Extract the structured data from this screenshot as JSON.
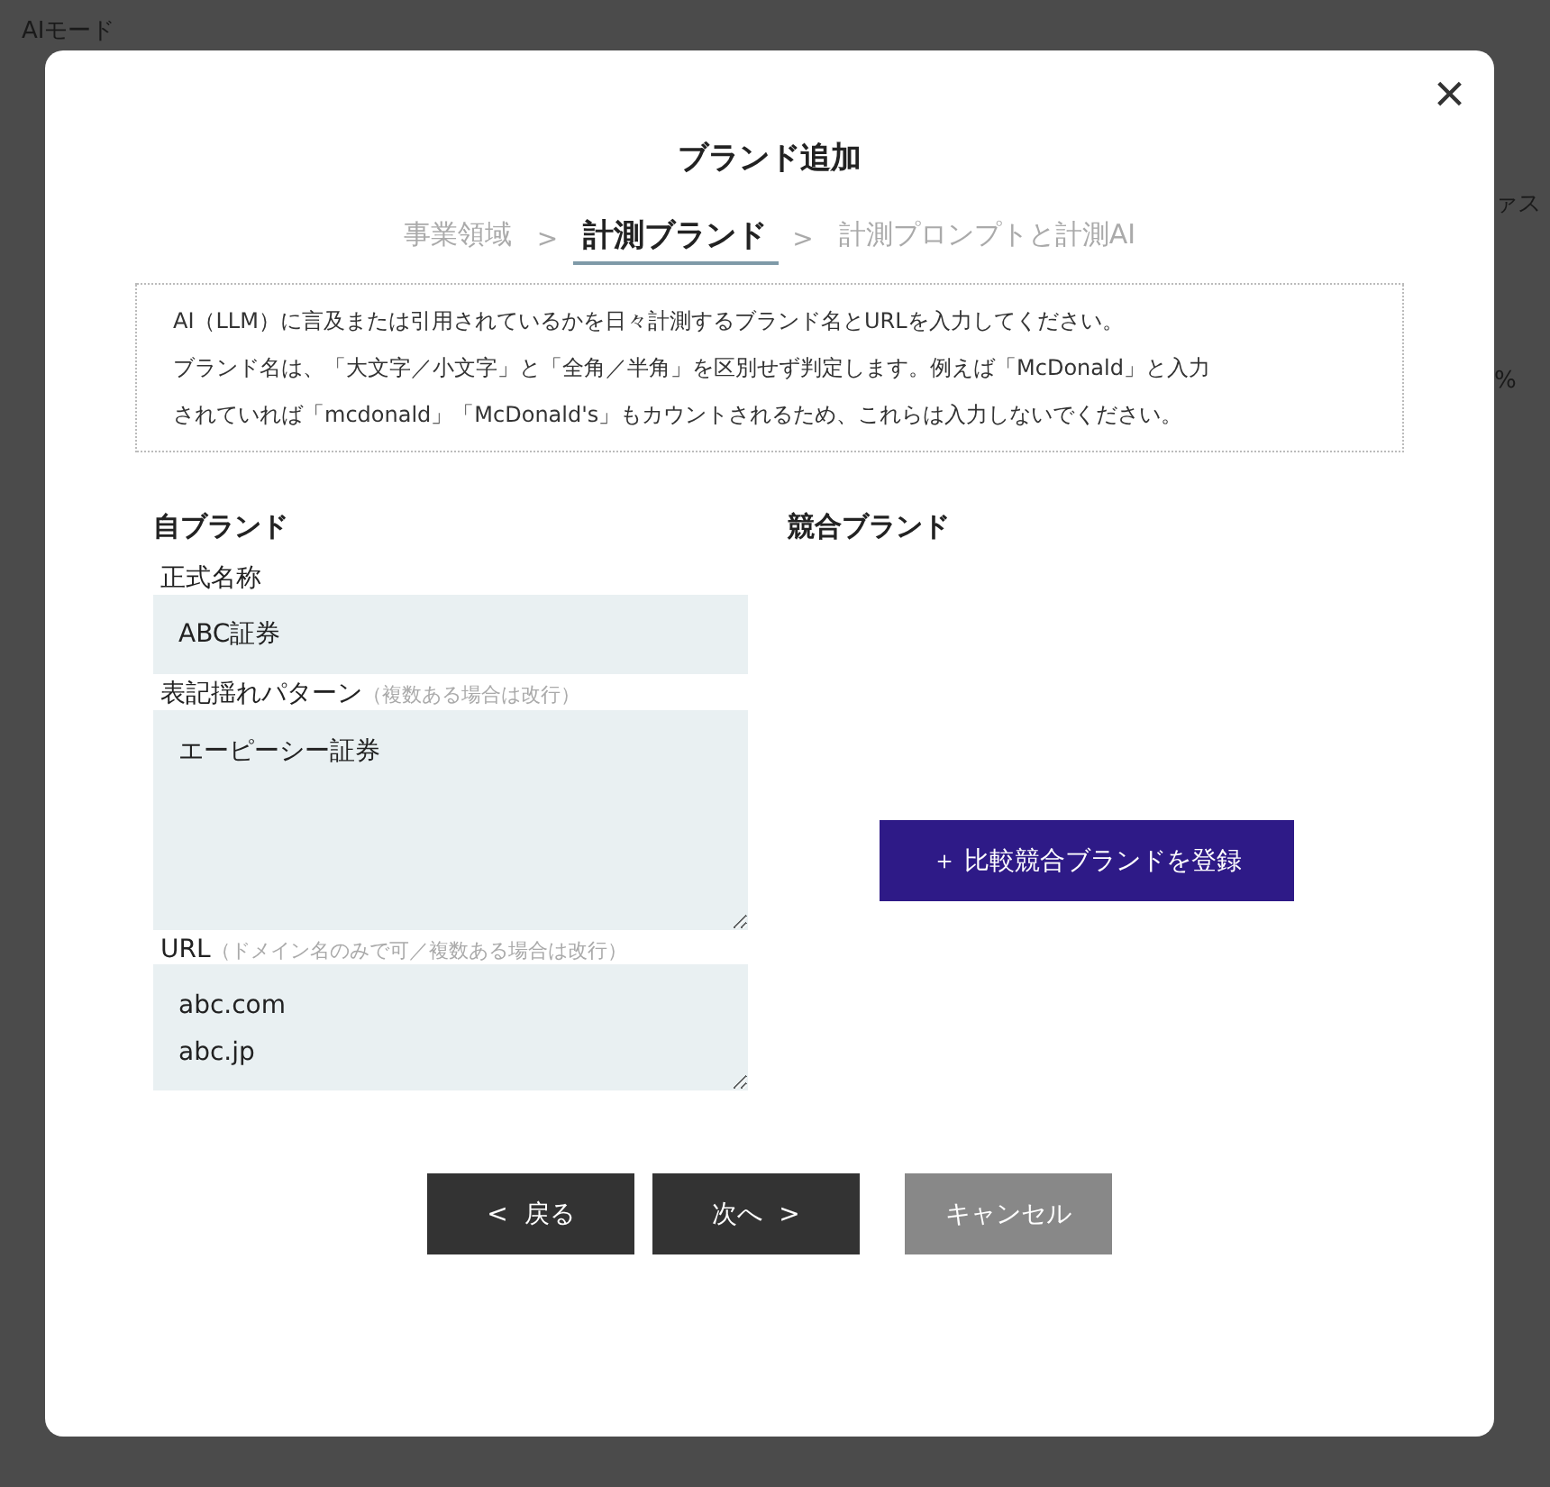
{
  "background": {
    "mode_label": "AIモード",
    "cut_texts": [
      "ァス",
      "%"
    ]
  },
  "dialog": {
    "close": "×",
    "title": "ブランド追加",
    "steps": [
      {
        "label": "事業領域",
        "selected": false
      },
      {
        "label": "計測ブランド",
        "selected": true
      },
      {
        "label": "計測プロンプトと計測AI",
        "selected": false
      }
    ],
    "step_separator": ">",
    "notice": [
      "AI（LLM）に言及または引用されているかを日々計測するブランド名とURLを入力してください。",
      "ブランド名は、「大文字／小文字」と「全角／半角」を区別せず判定します。例えば「McDonald」と入力",
      "されていれば「mcdonald」「McDonald's」もカウントされるため、これらは入力しないでください。"
    ],
    "own_brand": {
      "heading": "自ブランド",
      "fields": [
        {
          "kind": "input",
          "label": "正式名称",
          "value": "ABC証券"
        },
        {
          "kind": "textarea",
          "label": "表記揺れパターン",
          "hint": "（複数ある場合は改行）",
          "value": "エーピーシー証券"
        },
        {
          "kind": "textarea",
          "label": "URL",
          "hint": "（ドメイン名のみで可／複数ある場合は改行）",
          "value": "abc.com\nabc.jp"
        }
      ]
    },
    "competitors": {
      "heading": "競合ブランド",
      "add_button": "＋ 比較競合ブランドを登録"
    },
    "buttons": [
      {
        "kind": "back",
        "label": "<  戻る"
      },
      {
        "kind": "next",
        "label": "次へ  >"
      },
      {
        "kind": "cancel",
        "label": "キャンセル"
      }
    ]
  }
}
